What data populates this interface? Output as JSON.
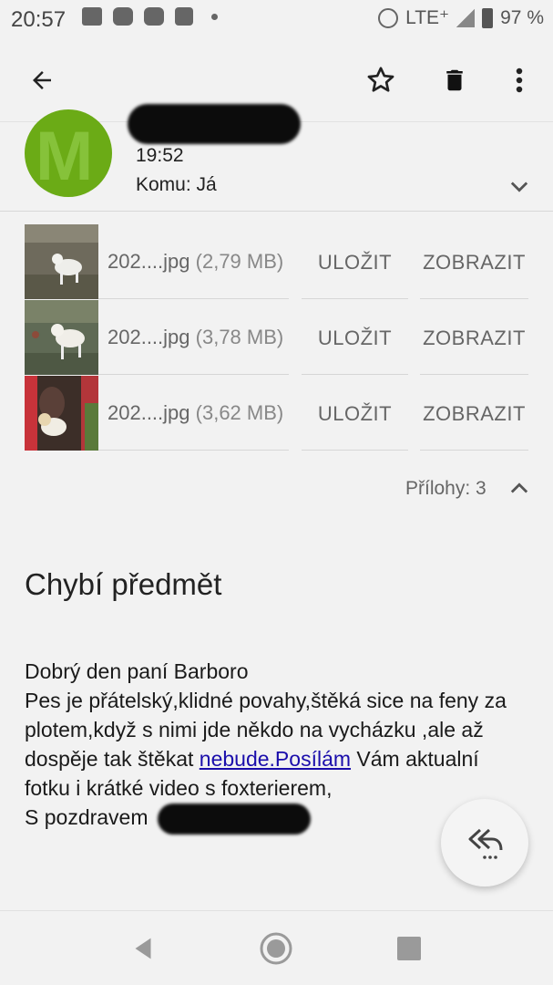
{
  "status_bar": {
    "time": "20:57",
    "network": "LTE⁺",
    "battery": "97 %"
  },
  "app_bar": {
    "back_icon": "arrow-left-icon",
    "star_icon": "star-outline-icon",
    "trash_icon": "trash-icon",
    "more_icon": "more-vert-icon"
  },
  "sender": {
    "avatar_letter": "M",
    "avatar_color": "#6bab16",
    "time": "19:52",
    "to": "Komu: Já"
  },
  "attachments": {
    "items": [
      {
        "name": "202....jpg",
        "size": "(2,79 MB)",
        "save_label": "ULOŽIT",
        "view_label": "ZOBRAZIT"
      },
      {
        "name": "202....jpg",
        "size": "(3,78 MB)",
        "save_label": "ULOŽIT",
        "view_label": "ZOBRAZIT"
      },
      {
        "name": "202....jpg",
        "size": "(3,62 MB)",
        "save_label": "ULOŽIT",
        "view_label": "ZOBRAZIT"
      }
    ],
    "count_label": "Přílohy: 3"
  },
  "message": {
    "subject": "Chybí předmět",
    "line1": "Dobrý den paní Barboro",
    "line2": "Pes je přátelský,klidné povahy,štěká sice na feny za plotem,když s nimi jde někdo na vycházku ,ale až dospěje tak štěkat",
    "link_text": "nebude.Posílám",
    "line3": " Vám aktualní fotku i krátké video s foxterierem,",
    "signature": "S pozdravem"
  },
  "colors": {
    "background": "#f2f2f2",
    "link": "#1a0dab",
    "avatar": "#6bab16"
  }
}
